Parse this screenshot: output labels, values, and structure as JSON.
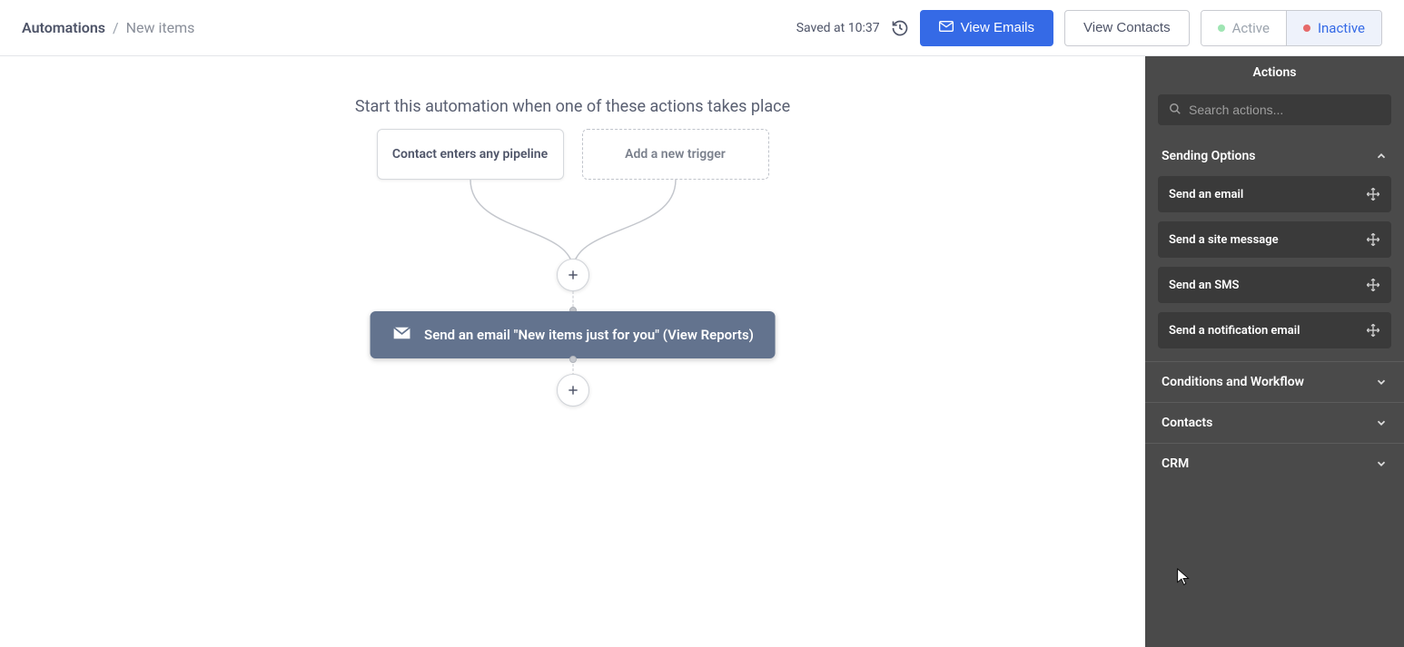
{
  "header": {
    "breadcrumb_root": "Automations",
    "breadcrumb_sep": "/",
    "breadcrumb_current": "New items",
    "saved_text": "Saved at 10:37",
    "view_emails": "View Emails",
    "view_contacts": "View Contacts",
    "toggle_active": "Active",
    "toggle_inactive": "Inactive"
  },
  "canvas": {
    "instruction": "Start this automation when one of these actions takes place",
    "trigger_solid": "Contact enters any pipeline",
    "trigger_dashed": "Add a new trigger",
    "action_card": "Send an email \"New items just for you\" (View Reports)"
  },
  "sidebar": {
    "title": "Actions",
    "search_placeholder": "Search actions...",
    "categories": [
      {
        "label": "Sending Options",
        "expanded": true,
        "items": [
          "Send an email",
          "Send a site message",
          "Send an SMS",
          "Send a notification email"
        ]
      },
      {
        "label": "Conditions and Workflow",
        "expanded": false
      },
      {
        "label": "Contacts",
        "expanded": false
      },
      {
        "label": "CRM",
        "expanded": false
      }
    ]
  }
}
